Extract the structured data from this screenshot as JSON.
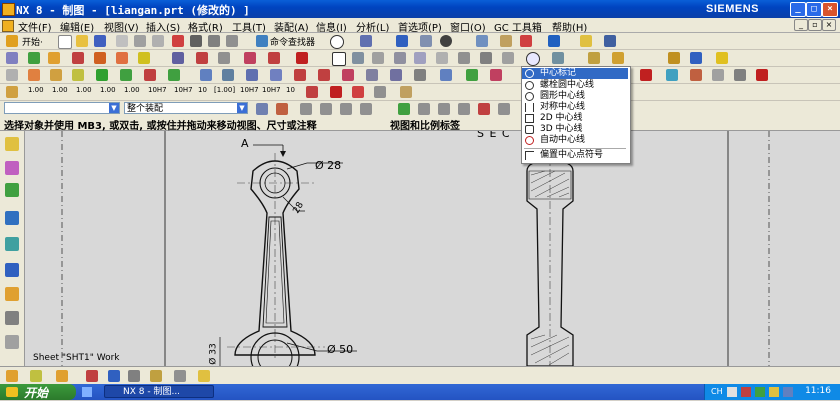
{
  "window": {
    "title": "NX 8 - 制图 - [liangan.prt  (修改的)  ]",
    "brand": "SIEMENS",
    "min": "_",
    "max": "□",
    "close": "×",
    "doc_min": "_",
    "doc_restore": "▫",
    "doc_close": "×"
  },
  "menu": [
    "文件(F)",
    "编辑(E)",
    "视图(V)",
    "插入(S)",
    "格式(R)",
    "工具(T)",
    "装配(A)",
    "信息(I)",
    "分析(L)",
    "首选项(P)",
    "窗口(O)",
    "GC 工具箱",
    "帮助(H)"
  ],
  "toolbar1": {
    "start": "开始·",
    "command_finder": "命令查找器"
  },
  "toolbar4": {
    "buttons": [
      "1.00",
      "1.00",
      "1.00",
      "1.00",
      "1.00",
      "10H7",
      "10H7",
      "10",
      "[1.00]",
      "10H7",
      "10H7",
      "10"
    ]
  },
  "selection_bar": {
    "filter_value": "",
    "scope_value": "整个装配"
  },
  "cue_line": {
    "prompt": "选择对象并使用 MB3, 或双击, 或按住并拖动来移动视图、尺寸或注释",
    "status": "视图和比例标签"
  },
  "dropdown": {
    "items": [
      {
        "label": "中心标记",
        "highlighted": true
      },
      {
        "label": "螺栓圆中心线",
        "highlighted": false
      },
      {
        "label": "圆形中心线",
        "highlighted": false
      },
      {
        "label": "对称中心线",
        "highlighted": false
      },
      {
        "label": "2D 中心线",
        "highlighted": false
      },
      {
        "label": "3D 中心线",
        "highlighted": false
      },
      {
        "label": "自动中心线",
        "highlighted": false
      },
      {
        "label": "偏置中心点符号",
        "highlighted": false
      }
    ]
  },
  "drawing": {
    "section_label": "A",
    "section_text": "S E C",
    "dim_diameter_top": "Ø 28",
    "dim_small": "28",
    "dim_diameter_bottom": "Ø 50",
    "dim_vertical": "Ø 33",
    "sheet_label": "Sheet \"SHT1\" Work"
  },
  "taskbar": {
    "start": "开始",
    "task_label": "NX 8 - 制图...",
    "lang": "CH",
    "clock": "11:16"
  },
  "colors": {
    "titlebar": "#0044c0",
    "highlight": "#316ac5",
    "canvas": "#d8d8d8",
    "taskbar": "#2453c2"
  }
}
